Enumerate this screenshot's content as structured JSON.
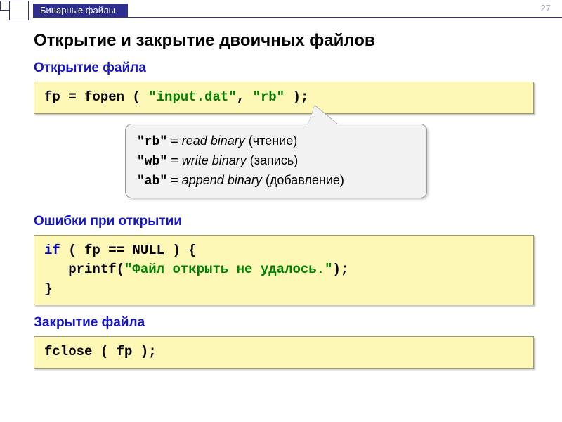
{
  "page_number": "27",
  "header_tab": "Бинарные файлы",
  "title": "Открытие и закрытие двоичных файлов",
  "section_open": "Открытие файла",
  "code1_pre": "fp = fopen ( ",
  "code1_arg1": "\"input.dat\"",
  "code1_mid": ", ",
  "code1_arg2": "\"rb\"",
  "code1_post": " );",
  "callout_l1a": "\"rb\"",
  "callout_l1b": " = ",
  "callout_l1c": "read binary",
  "callout_l1d": " (чтение)",
  "callout_l2a": "\"wb\"",
  "callout_l2b": " = ",
  "callout_l2c": "write binary",
  "callout_l2d": " (запись)",
  "callout_l3a": "\"ab\"",
  "callout_l3b": " = ",
  "callout_l3c": "append binary",
  "callout_l3d": " (добавление)",
  "section_err": "Ошибки при открытии",
  "code2_l1a": "if",
  "code2_l1b": " ( fp == NULL ) {",
  "code2_l2a": "   printf(",
  "code2_l2b": "\"Файл открыть не удалось.\"",
  "code2_l2c": ");",
  "code2_l3": "}",
  "section_close": "Закрытие файла",
  "code3": "fclose ( fp );"
}
